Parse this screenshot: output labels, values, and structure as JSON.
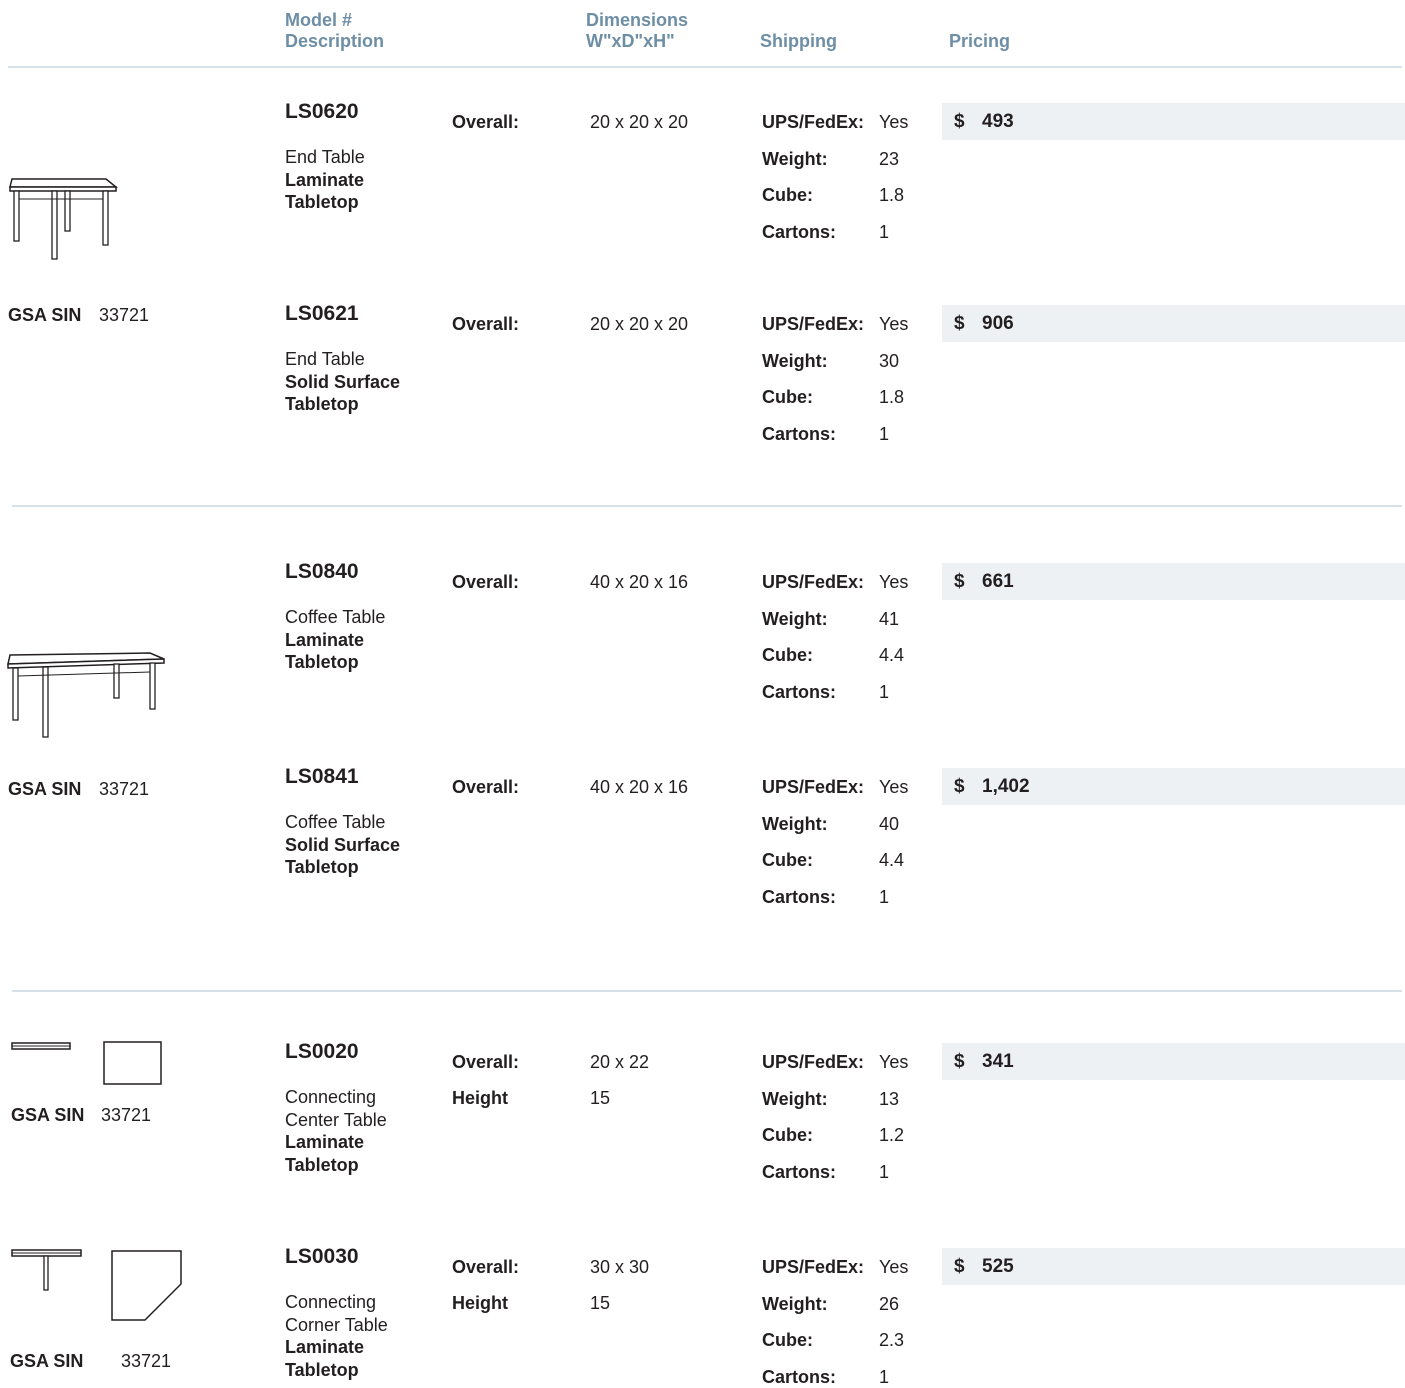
{
  "headers": {
    "model": "Model #",
    "description": "Description",
    "dimensions": "Dimensions",
    "dimensions_unit": "W\"xD\"xH\"",
    "shipping": "Shipping",
    "pricing": "Pricing"
  },
  "shipping_labels": {
    "ups": "UPS/FedEx:",
    "weight": "Weight:",
    "cube": "Cube:",
    "cartons": "Cartons:"
  },
  "currency": "$",
  "gsa": {
    "label": "GSA SIN",
    "number": "33721"
  },
  "products": [
    {
      "model": "LS0620",
      "desc1": "End Table",
      "desc2": "Laminate",
      "desc3": "Tabletop",
      "dim_label": "Overall:",
      "dim_value": "20 x 20 x 20",
      "ups": "Yes",
      "weight": "23",
      "cube": "1.8",
      "cartons": "1",
      "price": "493"
    },
    {
      "model": "LS0621",
      "desc1": "End Table",
      "desc2": "Solid Surface",
      "desc3": "Tabletop",
      "dim_label": "Overall:",
      "dim_value": "20 x 20 x 20",
      "ups": "Yes",
      "weight": "30",
      "cube": "1.8",
      "cartons": "1",
      "price": "906"
    },
    {
      "model": "LS0840",
      "desc1": "Coffee Table",
      "desc2": "Laminate",
      "desc3": "Tabletop",
      "dim_label": "Overall:",
      "dim_value": "40 x 20 x 16",
      "ups": "Yes",
      "weight": "41",
      "cube": "4.4",
      "cartons": "1",
      "price": "661"
    },
    {
      "model": "LS0841",
      "desc1": "Coffee Table",
      "desc2": "Solid Surface",
      "desc3": "Tabletop",
      "dim_label": "Overall:",
      "dim_value": "40 x 20 x 16",
      "ups": "Yes",
      "weight": "40",
      "cube": "4.4",
      "cartons": "1",
      "price": "1,402"
    },
    {
      "model": "LS0020",
      "desc1": "Connecting",
      "desc1b": "Center Table",
      "desc2": "Laminate",
      "desc3": "Tabletop",
      "dim_label": "Overall:",
      "dim_value": "20 x 22",
      "dim2_label": "Height",
      "dim2_value": "15",
      "ups": "Yes",
      "weight": "13",
      "cube": "1.2",
      "cartons": "1",
      "price": "341"
    },
    {
      "model": "LS0030",
      "desc1": "Connecting",
      "desc1b": "Corner Table",
      "desc2": "Laminate",
      "desc3": "Tabletop",
      "dim_label": "Overall:",
      "dim_value": "30 x 30",
      "dim2_label": "Height",
      "dim2_value": "15",
      "ups": "Yes",
      "weight": "26",
      "cube": "2.3",
      "cartons": "1",
      "price": "525"
    }
  ]
}
